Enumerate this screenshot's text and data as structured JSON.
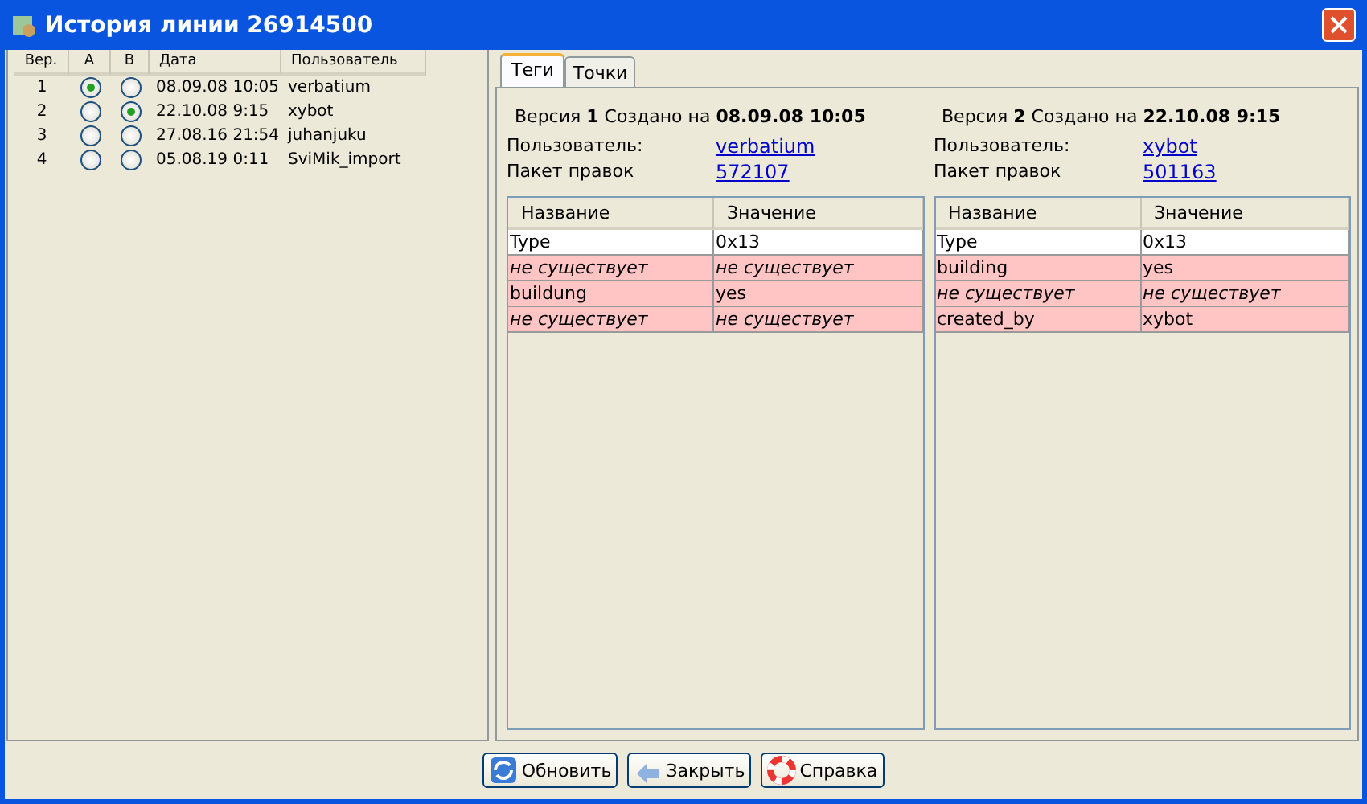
{
  "window": {
    "title": "История линии 26914500"
  },
  "history": {
    "columns": [
      "Вер.",
      "A",
      "B",
      "Дата",
      "Пользователь"
    ],
    "rows": [
      {
        "version": "1",
        "a_selected": true,
        "b_selected": false,
        "date": "08.09.08 10:05",
        "user": "verbatium"
      },
      {
        "version": "2",
        "a_selected": false,
        "b_selected": true,
        "date": "22.10.08 9:15",
        "user": "xybot"
      },
      {
        "version": "3",
        "a_selected": false,
        "b_selected": false,
        "date": "27.08.16 21:54",
        "user": "juhanjuku"
      },
      {
        "version": "4",
        "a_selected": false,
        "b_selected": false,
        "date": "05.08.19 0:11",
        "user": "SviMik_import"
      }
    ]
  },
  "tabs": [
    {
      "label": "Теги",
      "selected": true
    },
    {
      "label": "Точки",
      "selected": false
    }
  ],
  "versions": [
    {
      "heading": "Версия **1** Создано на **08.09.08 10:05**",
      "user_label": "Пользователь:",
      "user": "verbatium",
      "changeset_label": "Пакет правок",
      "changeset": "572107",
      "columns": [
        "Название",
        "Значение"
      ],
      "rows": [
        {
          "changed": false,
          "cells": [
            {
              "text": "Type",
              "missing": false
            },
            {
              "text": "0x13",
              "missing": false
            }
          ]
        },
        {
          "changed": true,
          "cells": [
            {
              "text": "не существует",
              "missing": true
            },
            {
              "text": "не существует",
              "missing": true
            }
          ]
        },
        {
          "changed": true,
          "cells": [
            {
              "text": "buildung",
              "missing": false
            },
            {
              "text": "yes",
              "missing": false
            }
          ]
        },
        {
          "changed": true,
          "cells": [
            {
              "text": "не существует",
              "missing": true
            },
            {
              "text": "не существует",
              "missing": true
            }
          ]
        }
      ]
    },
    {
      "heading": "Версия **2** Создано на **22.10.08 9:15**",
      "user_label": "Пользователь:",
      "user": "xybot",
      "changeset_label": "Пакет правок",
      "changeset": "501163",
      "columns": [
        "Название",
        "Значение"
      ],
      "rows": [
        {
          "changed": false,
          "cells": [
            {
              "text": "Type",
              "missing": false
            },
            {
              "text": "0x13",
              "missing": false
            }
          ]
        },
        {
          "changed": true,
          "cells": [
            {
              "text": "building",
              "missing": false
            },
            {
              "text": "yes",
              "missing": false
            }
          ]
        },
        {
          "changed": true,
          "cells": [
            {
              "text": "не существует",
              "missing": true
            },
            {
              "text": "не существует",
              "missing": true
            }
          ]
        },
        {
          "changed": true,
          "cells": [
            {
              "text": "created_by",
              "missing": false
            },
            {
              "text": "xybot",
              "missing": false
            }
          ]
        }
      ]
    }
  ],
  "buttons": [
    {
      "kind": "refresh",
      "label": "Обновить"
    },
    {
      "kind": "close",
      "label": "Закрыть"
    },
    {
      "kind": "help",
      "label": "Справка"
    }
  ]
}
